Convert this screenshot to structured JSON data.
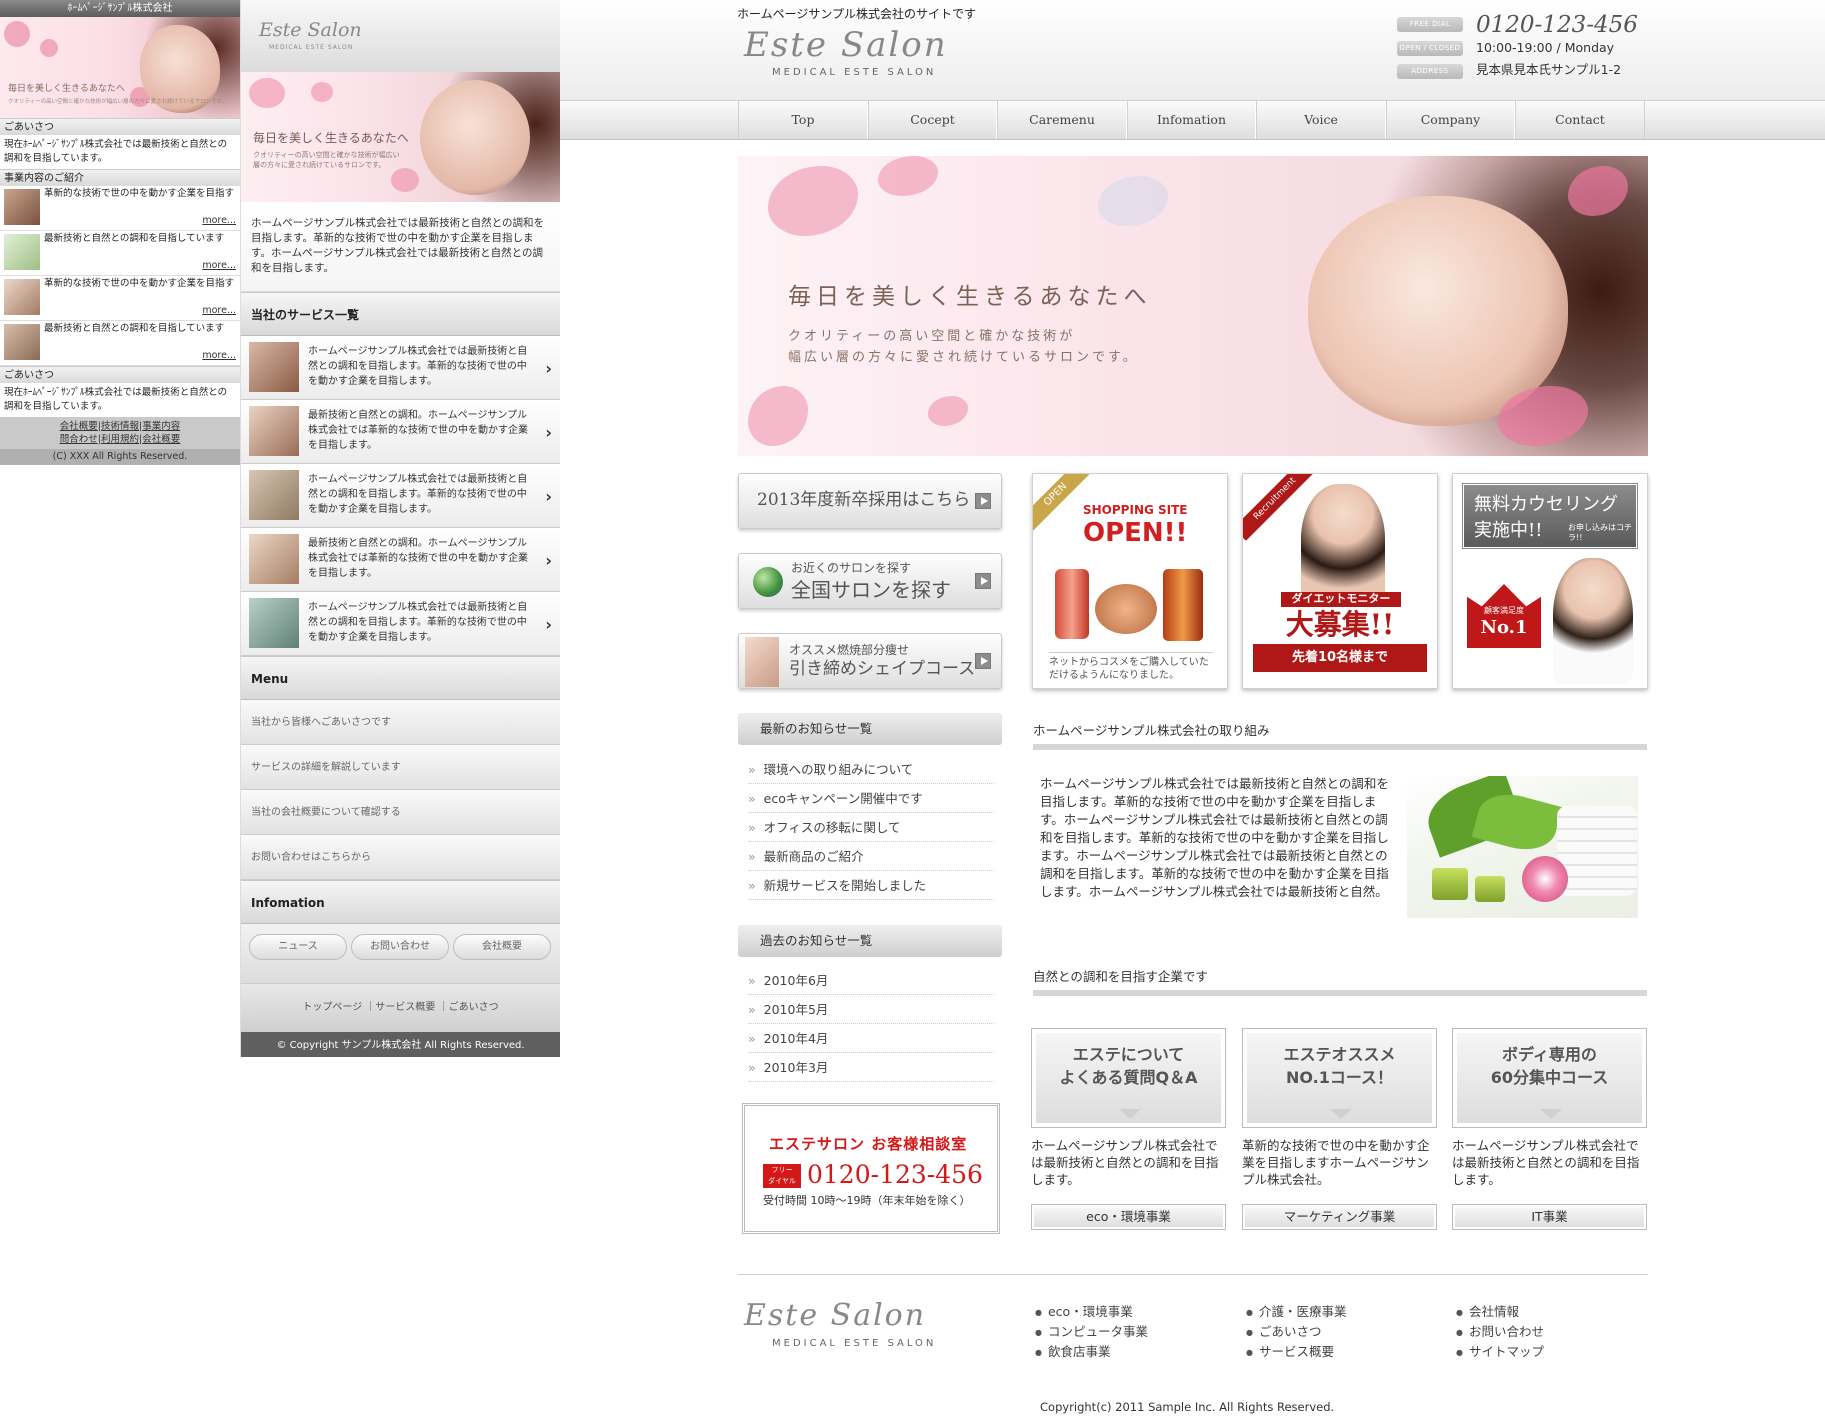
{
  "mobile": {
    "title": "ﾎｰﾑﾍﾟｰｼﾞｻﾝﾌﾟﾙ株式会社",
    "hero_headline": "毎日を美しく生きるあなたへ",
    "hero_sub": "クオリティーの高い空間と確かな技術が幅広い層の方々に愛され続けているサロンです。",
    "greeting_label": "ごあいさつ",
    "greeting_text": "現在ﾎｰﾑﾍﾟｰｼﾞｻﾝﾌﾟﾙ株式会社では最新技術と自然との調和を目指しています。",
    "business_label": "事業内容のご紹介",
    "items": [
      {
        "text": "革新的な技術で世の中を動かす企業を目指す",
        "more": "more..."
      },
      {
        "text": "最新技術と自然との調和を目指しています",
        "more": "more..."
      },
      {
        "text": "革新的な技術で世の中を動かす企業を目指す",
        "more": "more..."
      },
      {
        "text": "最新技術と自然との調和を目指しています",
        "more": "more..."
      }
    ],
    "greeting2_label": "ごあいさつ",
    "greeting2_text": "現在ﾎｰﾑﾍﾟｰｼﾞｻﾝﾌﾟﾙ株式会社では最新技術と自然との調和を目指しています。",
    "links": [
      "会社概要",
      "技術情報",
      "事業内容",
      "問合わせ",
      "利用規約",
      "会社概要"
    ],
    "copyright": "(C) XXX All Rights Reserved."
  },
  "smart": {
    "logo": "Este Salon",
    "logo_sub": "MEDICAL ESTE SALON",
    "hero_headline": "毎日を美しく生きるあなたへ",
    "hero_sub": "クオリティーの高い空間と確かな技術が幅広い層の方々に愛され続けているサロンです。",
    "intro": "ホームページサンプル株式会社では最新技術と自然との調和を目指します。革新的な技術で世の中を動かす企業を目指します。ホームページサンプル株式会社では最新技術と自然との調和を目指します。",
    "services_label": "当社のサービス一覧",
    "services": [
      "ホームページサンプル株式会社では最新技術と自然との調和を目指します。革新的な技術で世の中を動かす企業を目指します。",
      "最新技術と自然との調和。ホームページサンプル株式会社では革新的な技術で世の中を動かす企業を目指します。",
      "ホームページサンプル株式会社では最新技術と自然との調和を目指します。革新的な技術で世の中を動かす企業を目指します。",
      "最新技術と自然との調和。ホームページサンプル株式会社では革新的な技術で世の中を動かす企業を目指します。",
      "ホームページサンプル株式会社では最新技術と自然との調和を目指します。革新的な技術で世の中を動かす企業を目指します。"
    ],
    "menu_label": "Menu",
    "menu_items": [
      "当社から皆様へごあいさつです",
      "サービスの詳細を解説しています",
      "当社の会社概要について確認する",
      "お問い合わせはこちらから"
    ],
    "info_label": "Infomation",
    "info_buttons": [
      "ニュース",
      "お問い合わせ",
      "会社概要"
    ],
    "footer_links": [
      "トップページ",
      "｜サービス概要",
      "｜ごあいさつ"
    ],
    "copyright": "© Copyright サンプル株式会社 All Rights Reserved."
  },
  "desktop": {
    "tagline": "ホームページサンプル株式会社のサイトです",
    "logo": "Este Salon",
    "logo_sub": "MEDICAL ESTE SALON",
    "contact": {
      "free_dial_label": "FREE DIAL",
      "phone": "0120-123-456",
      "hours_label": "OPEN / CLOSED",
      "hours": "10:00-19:00 / Monday",
      "address_label": "ADDRESS",
      "address": "見本県見本氏サンプル1-2"
    },
    "nav": [
      "Top",
      "Cocept",
      "Caremenu",
      "Infomation",
      "Voice",
      "Company",
      "Contact"
    ],
    "hero": {
      "headline": "毎日を美しく生きるあなたへ",
      "sub1": "クオリティーの高い空間と確かな技術が",
      "sub2": "幅広い層の方々に愛され続けているサロンです。"
    },
    "side_buttons": {
      "recruit": "2013年度新卒採用はこちら",
      "search_small": "お近くのサロンを探す",
      "search_big": "全国サロンを探す",
      "course_small": "オススメ燃焼部分痩せ",
      "course_big": "引き締めシェイプコース"
    },
    "banners": {
      "shop_ribbon": "OPEN",
      "shop_title": "SHOPPING SITE",
      "shop_open": "OPEN!!",
      "shop_caption": "ネットからコスメをご購入していただけるようんになりました。",
      "recruit_ribbon": "Recruitment",
      "recruit_tag": "ダイエットモニター",
      "recruit_big": "大募集!!",
      "recruit_limit": "先着10名様まで",
      "counsel_title1": "無料カウセリング",
      "counsel_title2": "実施中!!",
      "counsel_small": "お申し込みはコチラ!!",
      "counsel_badge_small": "顧客満足度",
      "counsel_badge": "No.1"
    },
    "news_label": "最新のお知らせ一覧",
    "news": [
      "環境への取り組みについて",
      "ecoキャンペーン開催中です",
      "オフィスの移転に関して",
      "最新商品のご紹介",
      "新規サービスを開始しました"
    ],
    "archive_label": "過去のお知らせ一覧",
    "archive": [
      "2010年6月",
      "2010年5月",
      "2010年4月",
      "2010年3月"
    ],
    "consult": {
      "title": "エステサロン お客様相談室",
      "free1": "フリー",
      "free2": "ダイヤル",
      "phone": "0120-123-456",
      "hours": "受付時間 10時〜19時（年末年始を除く）"
    },
    "section1_title": "ホームページサンプル株式会社の取り組み",
    "section1_text": "ホームページサンプル株式会社では最新技術と自然との調和を目指します。革新的な技術で世の中を動かす企業を目指します。ホームページサンプル株式会社では最新技術と自然との調和を目指します。革新的な技術で世の中を動かす企業を目指します。ホームページサンプル株式会社では最新技術と自然との調和を目指します。革新的な技術で世の中を動かす企業を目指します。ホームページサンプル株式会社では最新技術と自然。",
    "section2_title": "自然との調和を目指す企業です",
    "features": [
      {
        "line1": "エステについて",
        "line2": "よくある質問Q＆A",
        "desc": "ホームページサンプル株式会社では最新技術と自然との調和を目指します。",
        "caption": "eco・環境事業"
      },
      {
        "line1": "エステオススメ",
        "line2": "NO.1コース！",
        "desc": "革新的な技術で世の中を動かす企業を目指しますホームページサンプル株式会社。",
        "caption": "マーケティング事業"
      },
      {
        "line1": "ボディ専用の",
        "line2": "60分集中コース",
        "desc": "ホームページサンプル株式会社では最新技術と自然との調和を目指します。",
        "caption": "IT事業"
      }
    ],
    "footer_cols": [
      [
        "eco・環境事業",
        "コンピュータ事業",
        "飲食店事業"
      ],
      [
        "介護・医療事業",
        "ごあいさつ",
        "サービス概要"
      ],
      [
        "会社情報",
        "お問い合わせ",
        "サイトマップ"
      ]
    ],
    "copyright": "Copyright(c) 2011 Sample Inc. All Rights Reserved."
  }
}
